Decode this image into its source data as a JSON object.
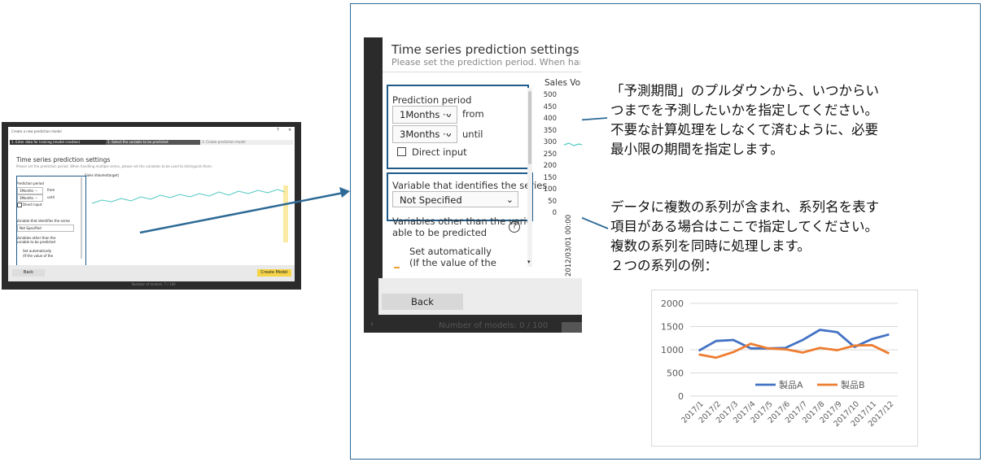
{
  "thumb": {
    "window_title": "Create a new prediction model",
    "help_icon": "?",
    "close_icon": "×",
    "steps": [
      "1. Enter data for training (model creation)",
      "2. Select the variable to be predicted",
      "3. Create prediction model"
    ],
    "title": "Time series prediction settings",
    "subtitle": "Please set the prediction period. When handling multiple series, please set the variables to be used to distinguish them.",
    "prediction_period_label": "Prediction period",
    "from_value": "1Months ···",
    "from_text": "from",
    "until_value": "3Months ···",
    "until_text": "until",
    "direct_input": "Direct input",
    "series_label": "Variable that identifies the series",
    "series_value": "Not Specified",
    "other_vars_label": "Variables other than the variable to be predicted",
    "set_auto": "Set automatically",
    "set_auto_2": "(If the value of the",
    "chart_label": "Sales Volume(target)",
    "back": "Back",
    "create": "Create Model",
    "models_count": "Number of models: 7 / 100"
  },
  "zoom": {
    "title": "Time series prediction settings",
    "subtitle": "Please set the prediction period. When handling",
    "prediction_period_label": "Prediction period",
    "from_value": "1Months ···",
    "from_text": "from",
    "until_value": "3Months ···",
    "until_text": "until",
    "direct_input": "Direct input",
    "series_label": "Variable that identifies the series",
    "series_value": "Not Specified",
    "other_vars_line1": "Variables other than the vari-",
    "other_vars_line2": "able to be predicted",
    "help_icon": "?",
    "set_auto_1": "Set automatically",
    "set_auto_2": "(If the value of the",
    "chart_label": "Sales Vol",
    "y_ticks": [
      "500",
      "450",
      "400",
      "350",
      "300",
      "250",
      "200",
      "150",
      "100",
      "50",
      "0"
    ],
    "x_tick": "2012/03/01 00:00",
    "back": "Back",
    "models_count": "Number of models: 0 / 100"
  },
  "annotations": {
    "period": [
      "「予測期間」のプルダウンから、いつからい",
      "つまでを予測したいかを指定してください。",
      "不要な計算処理をしなくて済むように、必要",
      "最小限の期間を指定します。"
    ],
    "series": [
      "データに複数の系列が含まれ、系列名を表す",
      "項目がある場合はここで指定してください。",
      "複数の系列を同時に処理します。",
      "２つの系列の例："
    ]
  },
  "colors": {
    "accent": "#f5d547",
    "highlight": "#1f5b8a",
    "teal": "#4fc8c0",
    "seriesA": "#4472c4",
    "seriesB": "#ed7d31"
  },
  "chart_data": {
    "type": "line",
    "categories": [
      "2017/1",
      "2017/2",
      "2017/3",
      "2017/4",
      "2017/5",
      "2017/6",
      "2017/7",
      "2017/8",
      "2017/9",
      "2017/10",
      "2017/11",
      "2017/12"
    ],
    "series": [
      {
        "name": "製品A",
        "values": [
          980,
          1190,
          1210,
          1030,
          1030,
          1040,
          1210,
          1430,
          1380,
          1060,
          1230,
          1330
        ]
      },
      {
        "name": "製品B",
        "values": [
          900,
          830,
          950,
          1130,
          1030,
          1010,
          940,
          1040,
          990,
          1090,
          1100,
          920
        ]
      }
    ],
    "y_ticks": [
      "2000",
      "1500",
      "1000",
      "500",
      "0"
    ],
    "ylim": [
      0,
      2000
    ],
    "legend": "bottom",
    "grid": true
  }
}
